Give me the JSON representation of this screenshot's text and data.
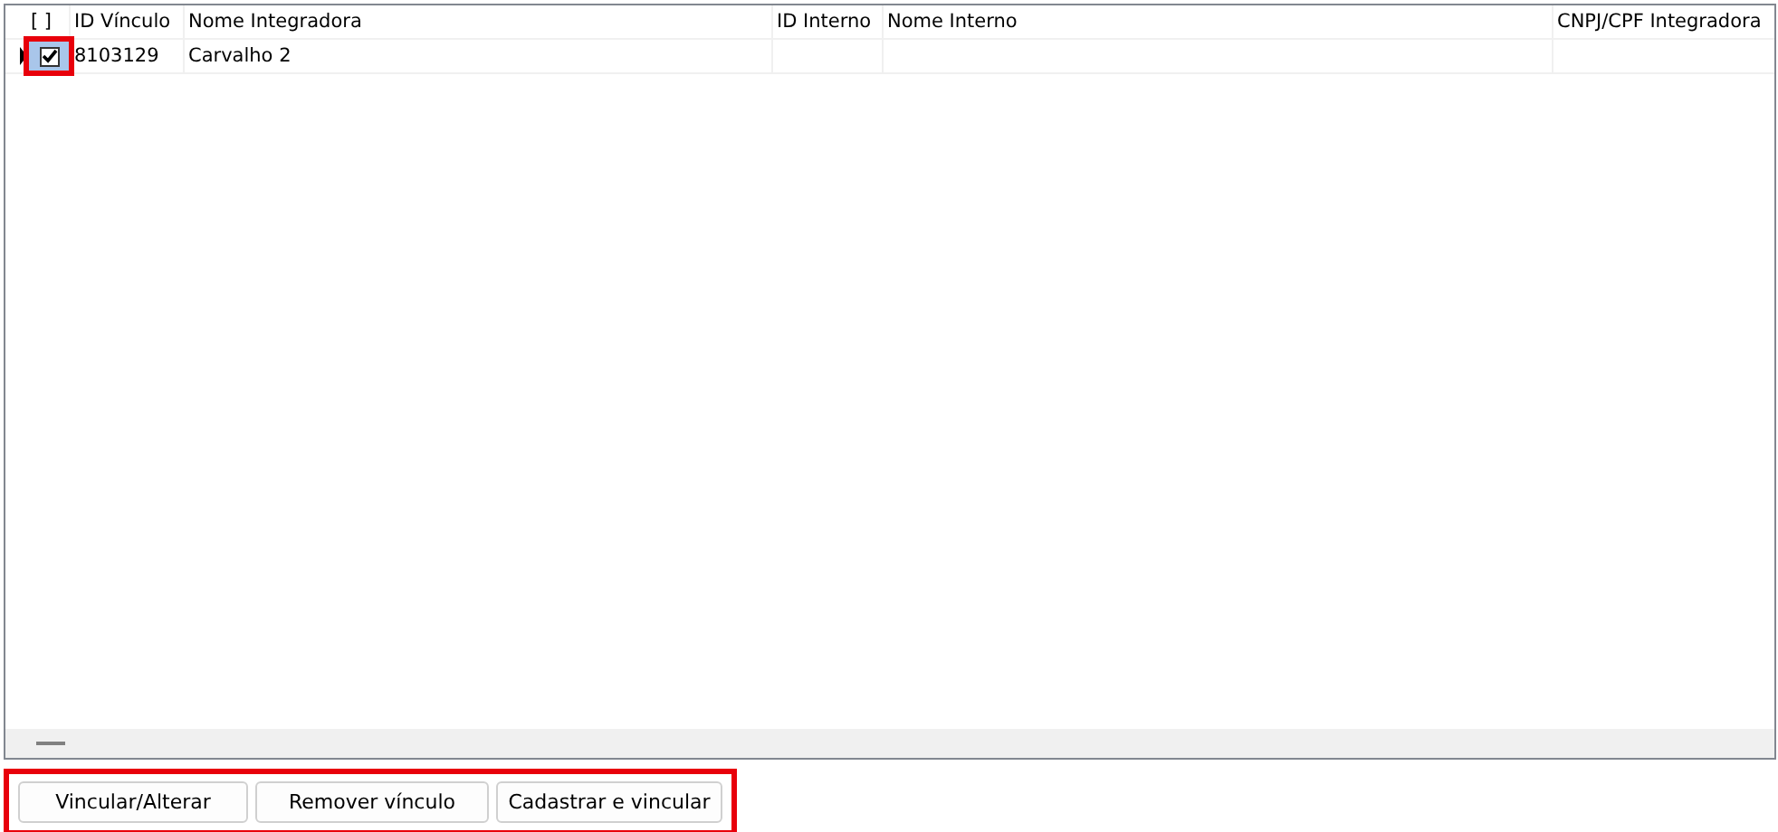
{
  "table": {
    "select_all_header": "[ ]",
    "columns": [
      "ID Vínculo",
      "Nome Integradora",
      "ID Interno",
      "Nome Interno",
      "CNPJ/CPF Integradora"
    ],
    "rows": [
      {
        "current": true,
        "checked": true,
        "cells": [
          "8103129",
          "Carvalho 2",
          "",
          "",
          ""
        ]
      }
    ]
  },
  "buttons": [
    "Vincular/Alterar",
    "Remover vínculo",
    "Cadastrar e vincular"
  ]
}
